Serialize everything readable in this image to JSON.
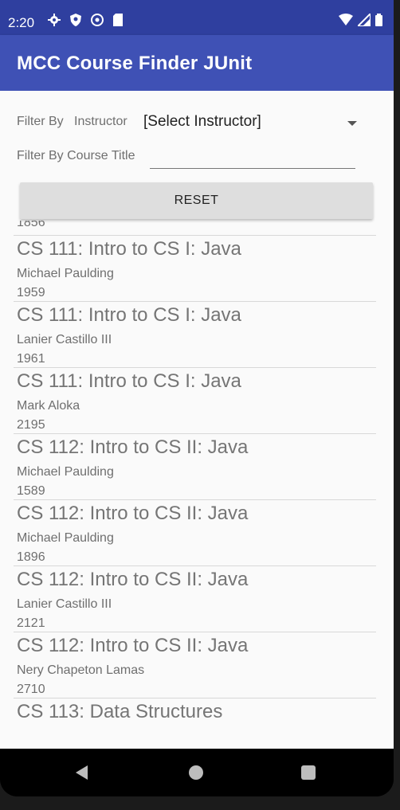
{
  "status_bar": {
    "time": "2:20",
    "icons": [
      "gear-icon",
      "shield-icon",
      "vpn-icon",
      "sd-card-icon"
    ],
    "right_icons": [
      "wifi-icon",
      "signal-icon",
      "battery-icon"
    ]
  },
  "app_bar": {
    "title": "MCC Course Finder JUnit"
  },
  "filters": {
    "instructor_label": "Filter By",
    "instructor_sub_label": "Instructor",
    "instructor_selected": "[Select Instructor]",
    "title_label": "Filter By Course Title",
    "title_value": "",
    "title_placeholder": ""
  },
  "reset_label": "RESET",
  "partial_top_text": "1856",
  "courses": [
    {
      "title": "CS 111: Intro to CS I: Java",
      "instructor": "Michael Paulding",
      "crn": "1959"
    },
    {
      "title": "CS 111: Intro to CS I: Java",
      "instructor": "Lanier Castillo III",
      "crn": "1961"
    },
    {
      "title": "CS 111: Intro to CS I: Java",
      "instructor": "Mark Aloka",
      "crn": "2195"
    },
    {
      "title": "CS 112: Intro to CS II: Java",
      "instructor": "Michael Paulding",
      "crn": "1589"
    },
    {
      "title": "CS 112: Intro to CS II: Java",
      "instructor": "Michael Paulding",
      "crn": "1896"
    },
    {
      "title": "CS 112: Intro to CS II: Java",
      "instructor": "Lanier Castillo III",
      "crn": "2121"
    },
    {
      "title": "CS 112: Intro to CS II: Java",
      "instructor": "Nery Chapeton Lamas",
      "crn": "2710"
    },
    {
      "title": "CS 113: Data Structures",
      "instructor": "",
      "crn": ""
    }
  ],
  "nav": {
    "back_icon": "back-triangle-icon",
    "home_icon": "home-circle-icon",
    "recent_icon": "recent-square-icon"
  },
  "colors": {
    "status_bar": "#2f3f9f",
    "app_bar": "#3f51b5",
    "background": "#fafafa",
    "button": "#dedede"
  }
}
